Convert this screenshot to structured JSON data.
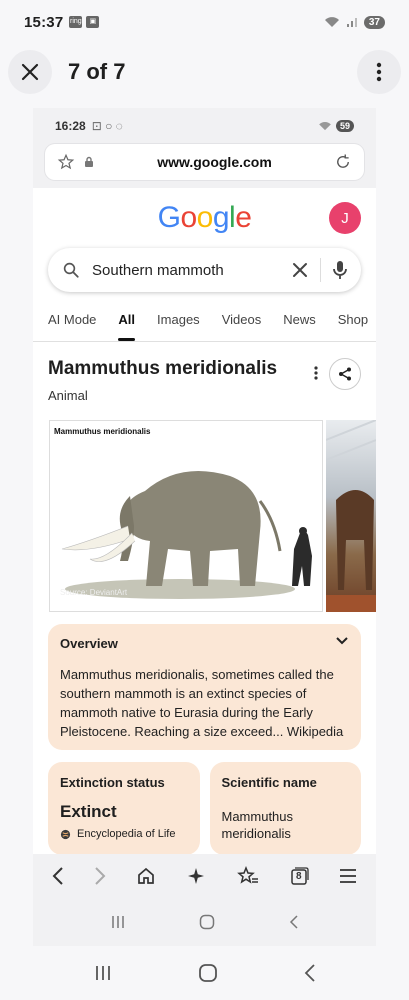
{
  "status": {
    "time": "15:37",
    "notif1": "ring",
    "battery": "37"
  },
  "viewer": {
    "title": "7 of 7"
  },
  "inner_status": {
    "time": "16:28",
    "battery": "59"
  },
  "urlbar": {
    "url": "www.google.com"
  },
  "google": {
    "logo_letters": [
      "G",
      "o",
      "o",
      "g",
      "l",
      "e"
    ],
    "logo_colors": [
      "#4285F4",
      "#EA4335",
      "#FBBC05",
      "#4285F4",
      "#34A853",
      "#EA4335"
    ],
    "avatar_letter": "J",
    "avatar_color": "#e8416c"
  },
  "search": {
    "query": "Southern mammoth"
  },
  "tabs": [
    "AI Mode",
    "All",
    "Images",
    "Videos",
    "News",
    "Shop"
  ],
  "knowledge_panel": {
    "title": "Mammuthus meridionalis",
    "subtitle": "Animal",
    "image_caption": "Mammuthus meridionalis",
    "image_source": "Source: DeviantArt"
  },
  "overview": {
    "heading": "Overview",
    "text": "Mammuthus meridionalis, sometimes called the southern mammoth is an extinct species of mammoth native to Eurasia during the Early Pleistocene. Reaching a size exceed",
    "source": "... Wikipedia"
  },
  "extinction": {
    "label": "Extinction status",
    "value": "Extinct",
    "source": "Encyclopedia of Life"
  },
  "scientific": {
    "label": "Scientific name",
    "value_line1": "Mammuthus",
    "value_line2": "meridionalis"
  },
  "browser_bar": {
    "tab_count": "8"
  }
}
